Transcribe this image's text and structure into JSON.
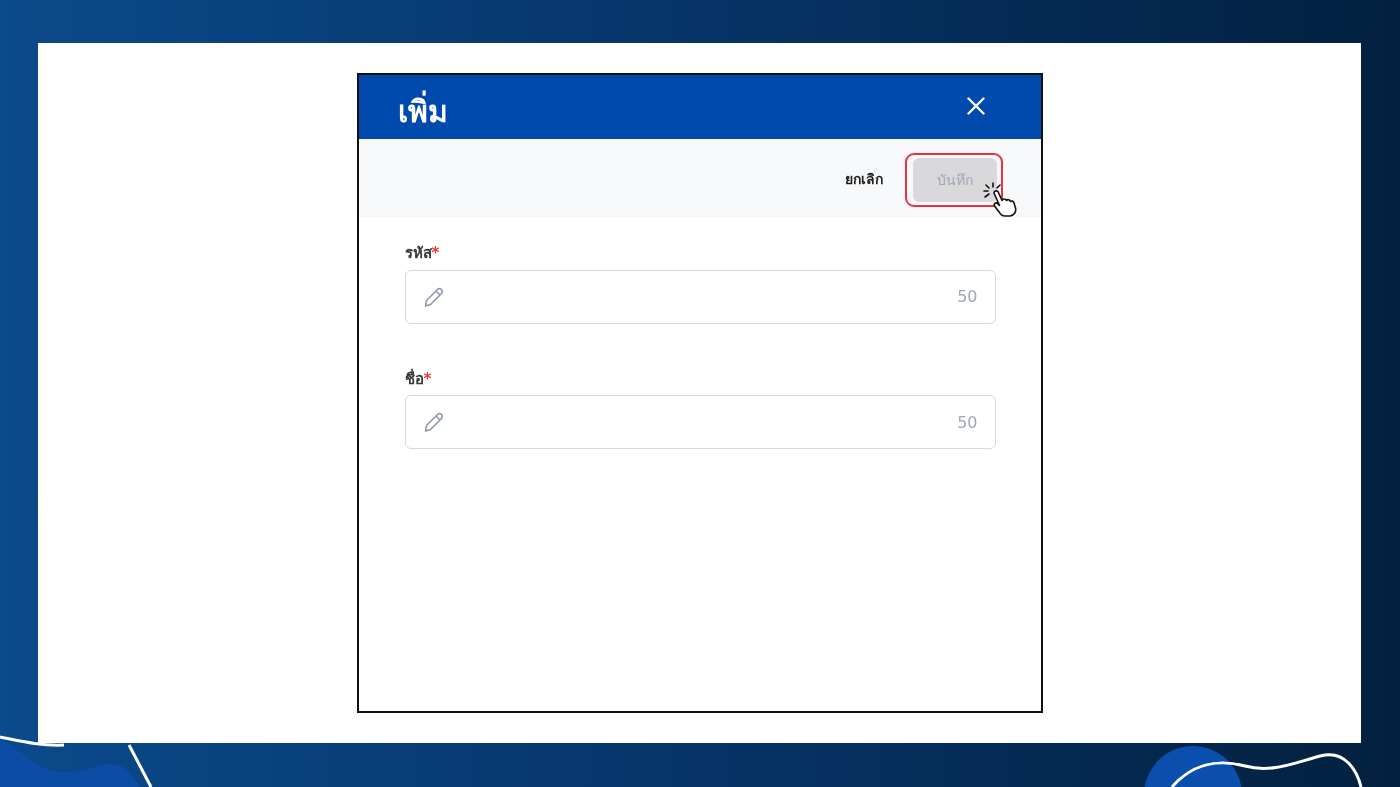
{
  "dialog": {
    "title": "เพิ่ม",
    "toolbar": {
      "buttons": [
        {
          "kind": "text",
          "label": "ยกเลิก",
          "disabled": false,
          "highlighted": false
        },
        {
          "kind": "primary",
          "label": "บันทึก",
          "disabled": true,
          "highlighted": true
        }
      ]
    },
    "fields": [
      {
        "label": "รหัส",
        "required_mark": "*",
        "counter": "50"
      },
      {
        "label": "ชื่อ",
        "required_mark": "*",
        "counter": "50"
      }
    ]
  }
}
